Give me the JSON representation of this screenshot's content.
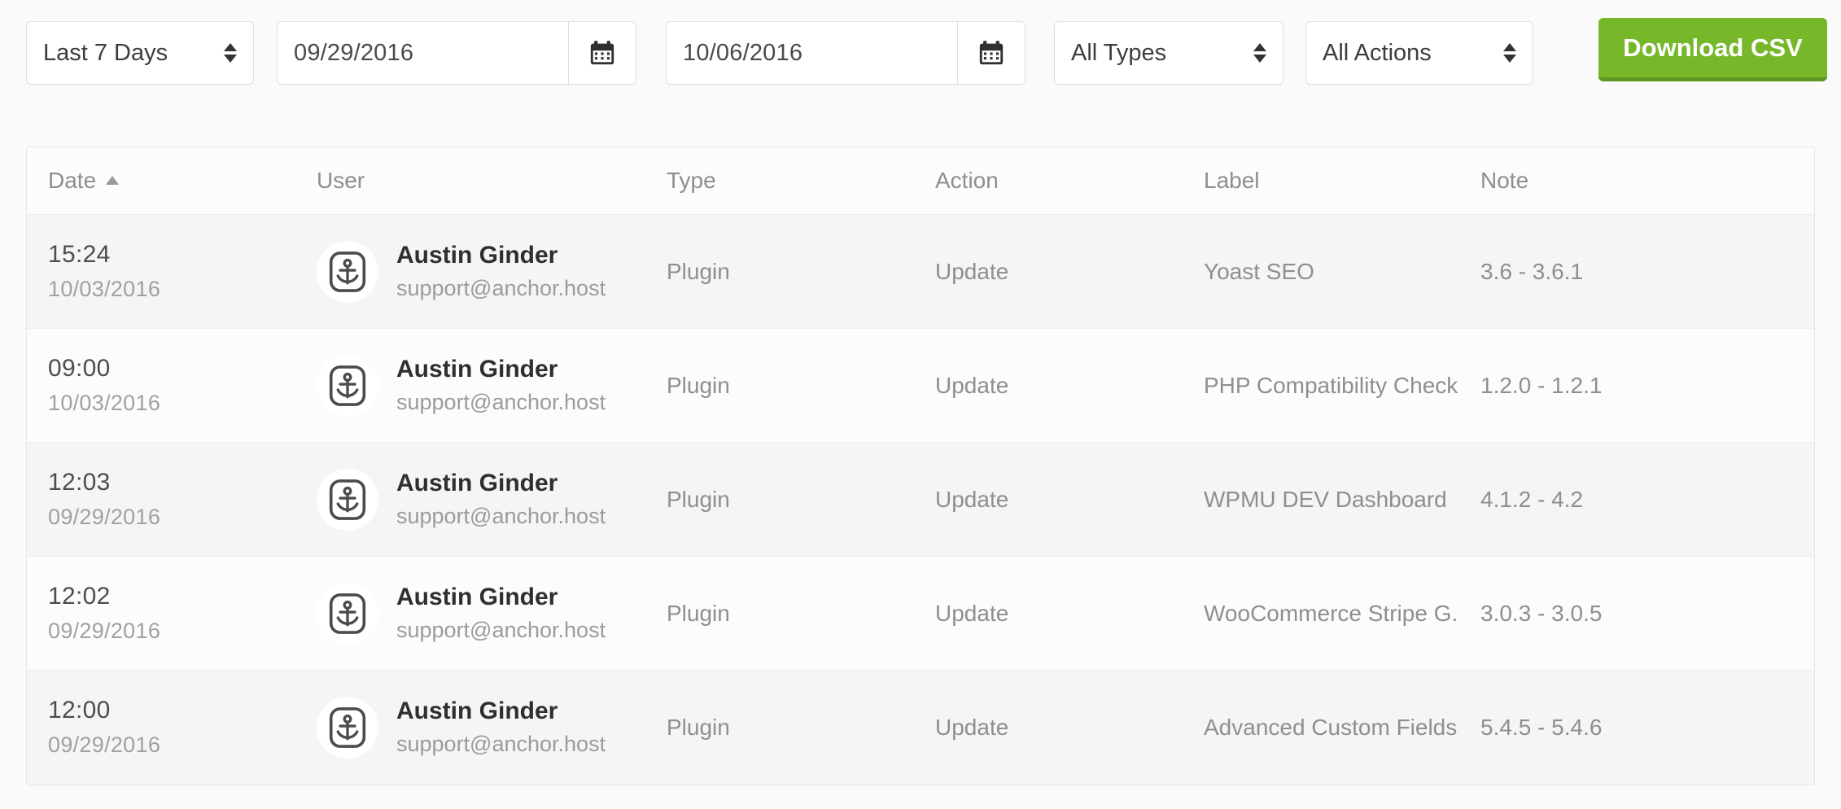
{
  "toolbar": {
    "range_select": {
      "value": "Last 7 Days",
      "icon": "chevron-updown-icon"
    },
    "date_from": {
      "value": "09/29/2016",
      "icon": "calendar-icon"
    },
    "date_to": {
      "value": "10/06/2016",
      "icon": "calendar-icon"
    },
    "type_select": {
      "value": "All Types",
      "icon": "chevron-updown-icon"
    },
    "action_select": {
      "value": "All Actions",
      "icon": "chevron-updown-icon"
    },
    "download_button": {
      "label": "Download CSV",
      "color": "#76b82a"
    }
  },
  "table": {
    "columns": [
      {
        "key": "date",
        "label": "Date",
        "sort": "asc"
      },
      {
        "key": "user",
        "label": "User"
      },
      {
        "key": "type",
        "label": "Type"
      },
      {
        "key": "action",
        "label": "Action"
      },
      {
        "key": "label",
        "label": "Label"
      },
      {
        "key": "note",
        "label": "Note"
      }
    ],
    "rows": [
      {
        "time": "15:24",
        "date": "10/03/2016",
        "user_name": "Austin Ginder",
        "user_email": "support@anchor.host",
        "avatar_icon": "anchor-icon",
        "type": "Plugin",
        "action": "Update",
        "label": "Yoast SEO",
        "note": "3.6 - 3.6.1"
      },
      {
        "time": "09:00",
        "date": "10/03/2016",
        "user_name": "Austin Ginder",
        "user_email": "support@anchor.host",
        "avatar_icon": "anchor-icon",
        "type": "Plugin",
        "action": "Update",
        "label": "PHP Compatibility Check...",
        "note": "1.2.0 - 1.2.1"
      },
      {
        "time": "12:03",
        "date": "09/29/2016",
        "user_name": "Austin Ginder",
        "user_email": "support@anchor.host",
        "avatar_icon": "anchor-icon",
        "type": "Plugin",
        "action": "Update",
        "label": "WPMU DEV Dashboard",
        "note": "4.1.2 - 4.2"
      },
      {
        "time": "12:02",
        "date": "09/29/2016",
        "user_name": "Austin Ginder",
        "user_email": "support@anchor.host",
        "avatar_icon": "anchor-icon",
        "type": "Plugin",
        "action": "Update",
        "label": "WooCommerce Stripe G...",
        "note": "3.0.3 - 3.0.5"
      },
      {
        "time": "12:00",
        "date": "09/29/2016",
        "user_name": "Austin Ginder",
        "user_email": "support@anchor.host",
        "avatar_icon": "anchor-icon",
        "type": "Plugin",
        "action": "Update",
        "label": "Advanced Custom Fields...",
        "note": "5.4.5 - 5.4.6"
      }
    ]
  }
}
